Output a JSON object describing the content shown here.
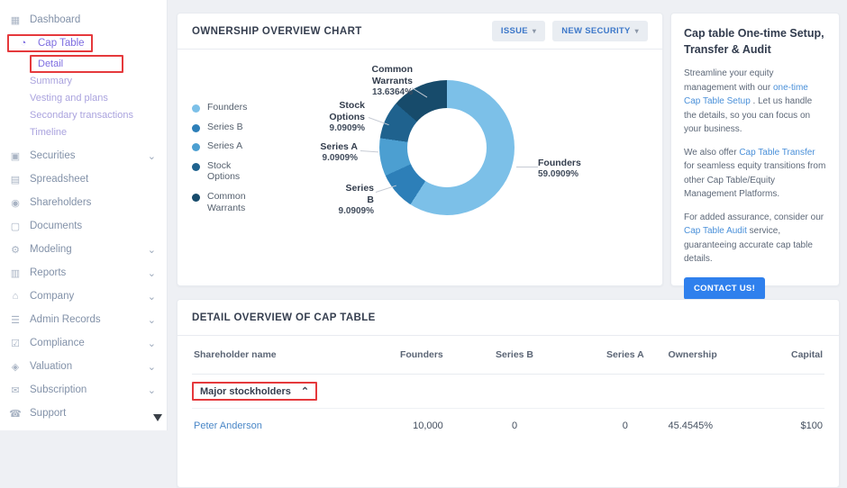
{
  "icons": {
    "dashboard": "▦",
    "cap_table": "◔",
    "securities": "▣",
    "spreadsheet": "▤",
    "shareholders": "◉",
    "documents": "▢",
    "modeling": "⚙",
    "reports": "▥",
    "company": "⌂",
    "admin_records": "☰",
    "compliance": "☑",
    "valuation": "◈",
    "subscription": "✉",
    "support": "☎",
    "chevron_down": "⌄",
    "chevron_up": "⌃",
    "caret_down": "▾"
  },
  "colors": {
    "accent_purple": "#7d6ce0",
    "link_blue": "#4a90d9",
    "annotation_red": "#e5393c",
    "contact_blue": "#2f80ed"
  },
  "sidebar": {
    "items": {
      "dashboard": "Dashboard",
      "cap_table": "Cap Table",
      "detail": "Detail",
      "summary": "Summary",
      "vesting": "Vesting and plans",
      "secondary": "Secondary transactions",
      "timeline": "Timeline",
      "securities": "Securities",
      "spreadsheet": "Spreadsheet",
      "shareholders": "Shareholders",
      "documents": "Documents",
      "modeling": "Modeling",
      "reports": "Reports",
      "company": "Company",
      "admin_records": "Admin Records",
      "compliance": "Compliance",
      "valuation": "Valuation",
      "subscription": "Subscription",
      "support": "Support"
    }
  },
  "ownership_card": {
    "title": "OWNERSHIP OVERVIEW CHART",
    "issue_label": "ISSUE",
    "new_security_label": "NEW SECURITY"
  },
  "chart_data": {
    "type": "pie",
    "title": "OWNERSHIP OVERVIEW CHART",
    "donut": true,
    "legend_position": "left",
    "segments": [
      {
        "label": "Founders",
        "value": 59.0909,
        "display": "59.0909%",
        "color": "#7CC0E8"
      },
      {
        "label": "Series B",
        "value": 9.0909,
        "display": "9.0909%",
        "color": "#2D7FB8"
      },
      {
        "label": "Series A",
        "value": 9.0909,
        "display": "9.0909%",
        "color": "#4C9FD1"
      },
      {
        "label": "Stock Options",
        "value": 9.0909,
        "display": "9.0909%",
        "color": "#1F628E"
      },
      {
        "label": "Common Warrants",
        "value": 13.6364,
        "display": "13.6364%",
        "color": "#174B6B"
      }
    ]
  },
  "promo": {
    "title": "Cap table One-time Setup, Transfer & Audit",
    "p1_a": "Streamline your equity management with our ",
    "p1_link": "one-time Cap Table Setup",
    "p1_b": " . Let us handle the details, so you can focus on your business.",
    "p2_a": "We also offer ",
    "p2_link": "Cap Table Transfer",
    "p2_b": " for seamless equity transitions from other Cap Table/Equity Management Platforms.",
    "p3_a": "For added assurance, consider our ",
    "p3_link": "Cap Table Audit",
    "p3_b": " service, guaranteeing accurate cap table details.",
    "contact_label": "CONTACT US!"
  },
  "detail_card": {
    "title": "DETAIL OVERVIEW OF CAP TABLE",
    "columns": [
      "Shareholder name",
      "Founders",
      "Series B",
      "Series A",
      "Ownership",
      "Capital"
    ],
    "group_label": "Major stockholders",
    "rows": [
      {
        "name": "Peter Anderson",
        "founders": "10,000",
        "series_b": "0",
        "series_a": "0",
        "ownership": "45.4545%",
        "capital": "$100"
      }
    ]
  }
}
